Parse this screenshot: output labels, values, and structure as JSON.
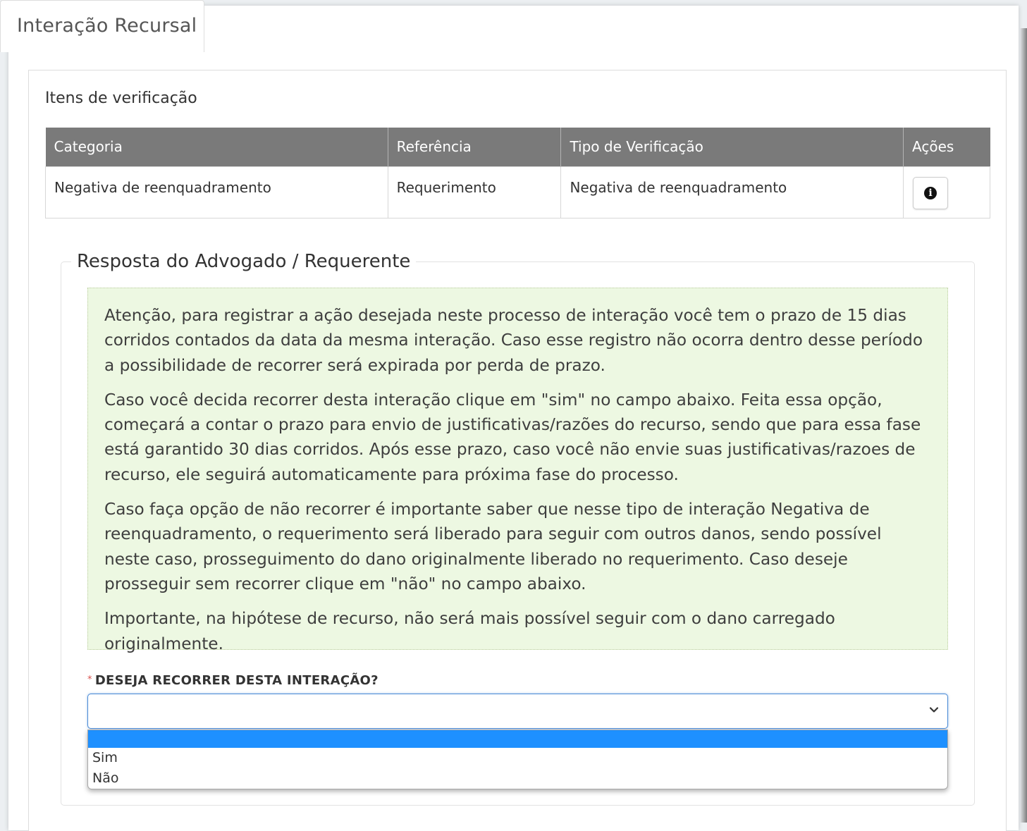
{
  "tab": {
    "label": "Interação Recursal"
  },
  "section": {
    "title": "Itens de verificação"
  },
  "table": {
    "headers": [
      "Categoria",
      "Referência",
      "Tipo de Verificação",
      "Ações"
    ],
    "rows": [
      {
        "categoria": "Negativa de reenquadramento",
        "referencia": "Requerimento",
        "tipo": "Negativa de reenquadramento",
        "acao_icon": "info-circle-icon"
      }
    ]
  },
  "resposta": {
    "legend": "Resposta do Advogado / Requerente",
    "paragraphs": [
      "Atenção, para registrar a ação desejada neste processo de interação você tem o prazo de 15 dias corridos contados da data da mesma interação. Caso esse registro não ocorra dentro desse período a possibilidade de recorrer será expirada por perda de prazo.",
      "Caso você decida recorrer desta interação clique em \"sim\" no campo abaixo. Feita essa opção, começará a contar o prazo para envio de justificativas/razões do recurso, sendo que para essa fase está garantido 30 dias corridos. Após esse prazo, caso você não envie suas justificativas/razoes de recurso, ele seguirá automaticamente para próxima fase do processo.",
      "Caso faça opção de não recorrer é importante saber que nesse tipo de interação Negativa de reenquadramento, o requerimento será liberado para seguir com outros danos, sendo possível neste caso, prosseguimento do dano originalmente liberado no requerimento. Caso deseje prosseguir sem recorrer clique em \"não\" no campo abaixo.",
      "Importante, na hipótese de recurso, não será mais possível seguir com o dano carregado originalmente."
    ],
    "question": {
      "required_mark": "*",
      "label": "DESEJA RECORRER DESTA INTERAÇÃO?",
      "value": "",
      "options": [
        "",
        "Sim",
        "Não"
      ]
    }
  },
  "colors": {
    "table_header": "#7a7a7a",
    "alert_background": "#edf8e2",
    "option_highlight": "#1e90ff",
    "required_mark": "#d9534f"
  }
}
